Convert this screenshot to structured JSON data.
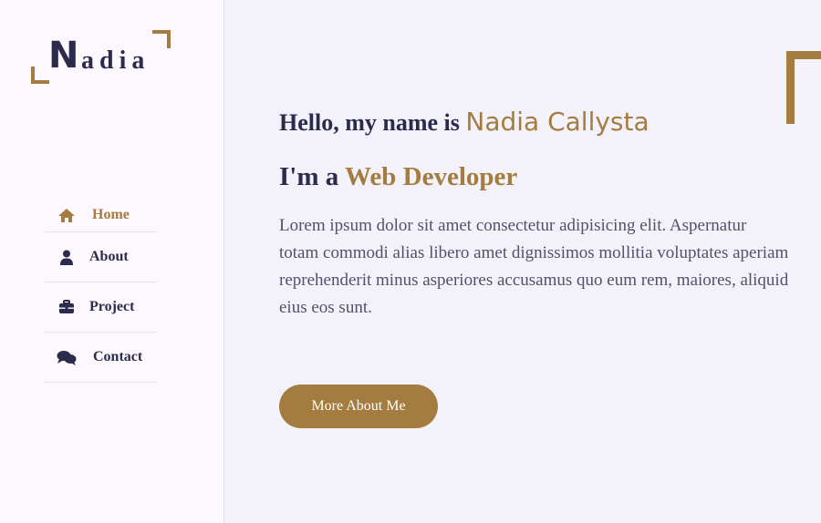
{
  "logo": {
    "initial": "N",
    "rest": "adia"
  },
  "nav": {
    "items": [
      {
        "label": "Home",
        "icon": "home-icon",
        "active": true
      },
      {
        "label": "About",
        "icon": "user-icon",
        "active": false
      },
      {
        "label": "Project",
        "icon": "briefcase-icon",
        "active": false
      },
      {
        "label": "Contact",
        "icon": "comments-icon",
        "active": false
      }
    ]
  },
  "hero": {
    "greeting": "Hello, my name is ",
    "name": "Nadia Callysta",
    "role_prefix": "I'm a ",
    "role": "Web Developer",
    "description": "Lorem ipsum dolor sit amet consectetur adipisicing elit. Aspernatur totam commodi alias libero amet dignissimos mollitia voluptates aperiam reprehenderit minus asperiores accusamus quo eum rem, maiores, aliquid eius eos sunt.",
    "button_label": "More About Me"
  },
  "colors": {
    "accent": "#a57c3f",
    "text": "#2b2b4d",
    "sidebar_bg": "#fcf8fd",
    "main_bg": "#f3f1fa"
  }
}
